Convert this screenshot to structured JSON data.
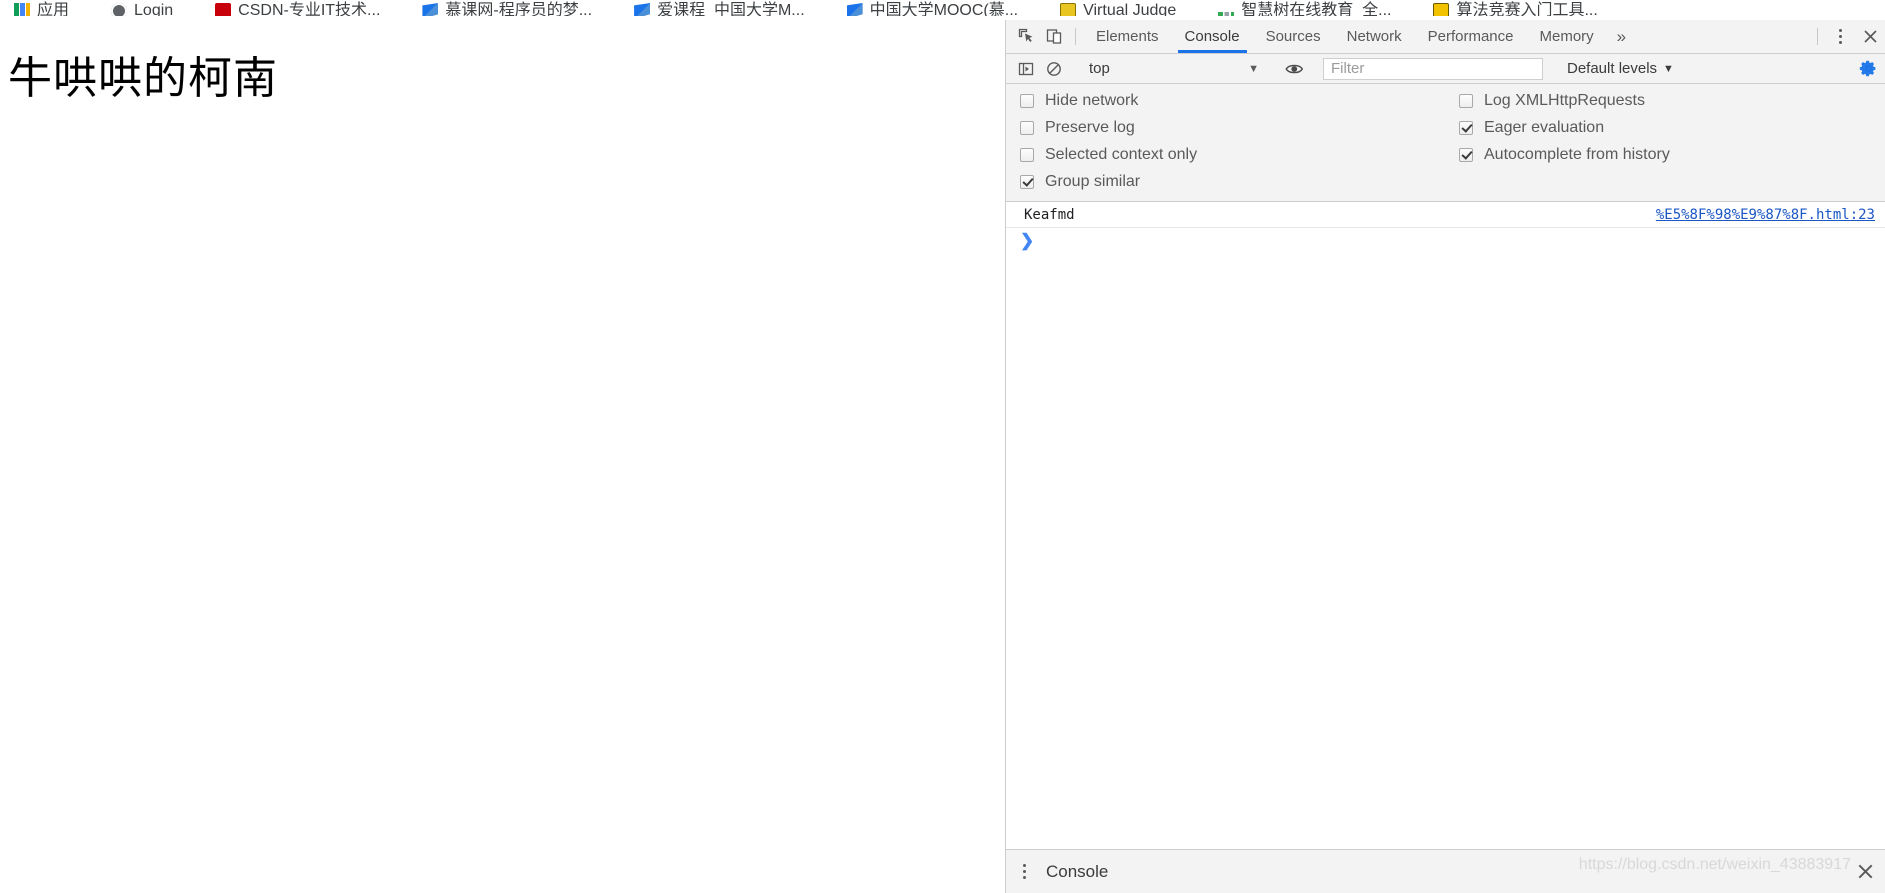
{
  "bookmarks": [
    {
      "label": "应用",
      "icon": "apps-grid-icon"
    },
    {
      "label": "Login",
      "icon": "login-icon"
    },
    {
      "label": "CSDN-专业IT技术...",
      "icon": "csdn-icon"
    },
    {
      "label": "慕课网-程序员的梦...",
      "icon": "flag-icon"
    },
    {
      "label": "爱课程_中国大学M...",
      "icon": "flag-icon"
    },
    {
      "label": "中国大学MOOC(慕...",
      "icon": "flag-icon"
    },
    {
      "label": "Virtual Judge",
      "icon": "virtual-judge-icon"
    },
    {
      "label": "智慧树在线教育_全...",
      "icon": "dots-icon"
    },
    {
      "label": "算法竞赛入门工具...",
      "icon": "tool-icon"
    }
  ],
  "page": {
    "heading": "牛哄哄的柯南"
  },
  "devtools": {
    "tabs": [
      {
        "label": "Elements",
        "active": false
      },
      {
        "label": "Console",
        "active": true
      },
      {
        "label": "Sources",
        "active": false
      },
      {
        "label": "Network",
        "active": false
      },
      {
        "label": "Performance",
        "active": false
      },
      {
        "label": "Memory",
        "active": false
      }
    ],
    "more_tabs_label": "»",
    "inspect_icon": "inspect-element-icon",
    "device_icon": "toggle-device-toolbar-icon",
    "kebab_icon": "more-options-icon",
    "close_icon": "close-devtools-icon",
    "accent_color": "#1a73e8",
    "console_toolbar": {
      "sidebar_icon": "console-sidebar-icon",
      "clear_icon": "clear-console-icon",
      "context": "top",
      "context_caret": "▼",
      "eye_icon": "live-expression-icon",
      "filter_placeholder": "Filter",
      "filter_value": "",
      "levels_label": "Default levels",
      "levels_caret": "▼",
      "gear_icon": "console-settings-gear-icon",
      "gear_color": "#1a73e8"
    },
    "settings": {
      "left": [
        {
          "label": "Hide network",
          "checked": false
        },
        {
          "label": "Preserve log",
          "checked": false
        },
        {
          "label": "Selected context only",
          "checked": false
        },
        {
          "label": "Group similar",
          "checked": true
        }
      ],
      "right": [
        {
          "label": "Log XMLHttpRequests",
          "checked": false
        },
        {
          "label": "Eager evaluation",
          "checked": true
        },
        {
          "label": "Autocomplete from history",
          "checked": true
        }
      ]
    },
    "log": {
      "entries": [
        {
          "message": "Keafmd",
          "source": "%E5%8F%98%E9%87%8F.html:23"
        }
      ],
      "prompt_arrow": "❯"
    },
    "drawer": {
      "kebab_icon": "drawer-more-options-icon",
      "tab_label": "Console",
      "close_icon": "close-drawer-icon"
    }
  },
  "watermark": "https://blog.csdn.net/weixin_43883917"
}
